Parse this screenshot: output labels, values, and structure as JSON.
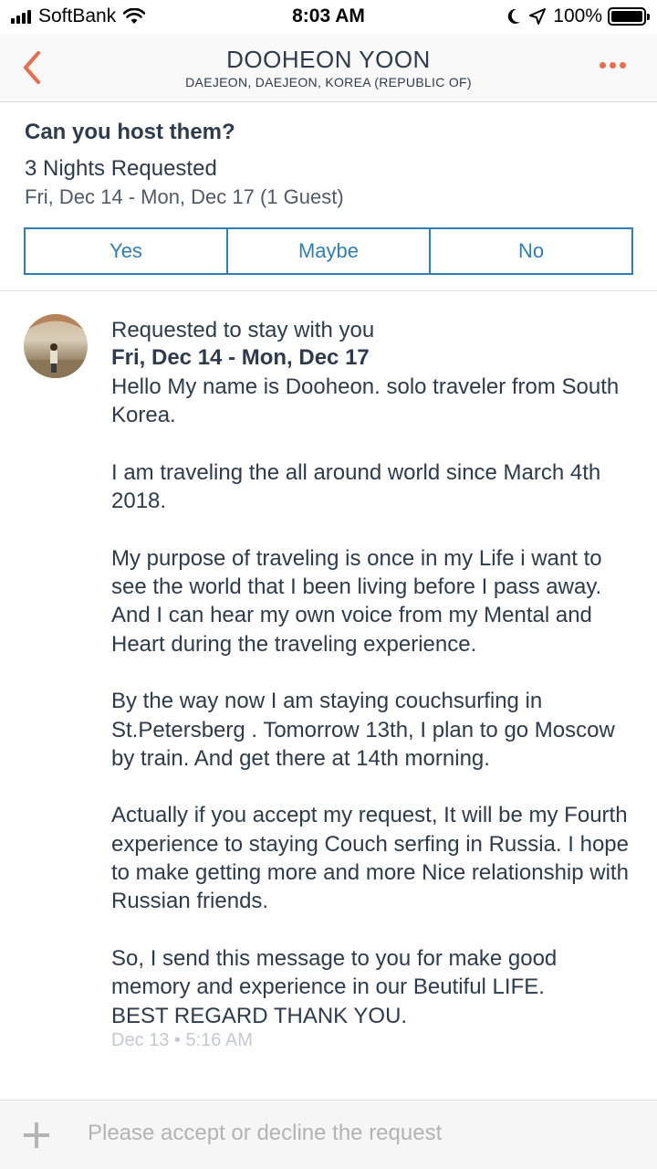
{
  "status_bar": {
    "carrier": "SoftBank",
    "time": "8:03 AM",
    "battery": "100%"
  },
  "header": {
    "title": "DOOHEON YOON",
    "subtitle": "DAEJEON, DAEJEON, KOREA (REPUBLIC OF)"
  },
  "request": {
    "question": "Can you host them?",
    "nights": "3 Nights Requested",
    "dates": "Fri, Dec 14 - Mon, Dec 17 (1 Guest)",
    "options": [
      "Yes",
      "Maybe",
      "No"
    ]
  },
  "message": {
    "title": "Requested to stay with you",
    "dates": "Fri, Dec 14 - Mon, Dec 17",
    "body": "Hello My name is Dooheon. solo traveler from South Korea.\n\nI am traveling the all around world since March 4th 2018.\n\nMy purpose of traveling is once in my Life i want to see the world that I been living before I pass away. And I can hear my own voice from my Mental and Heart during the traveling experience.\n\nBy the way now I am staying couchsurfing in St.Petersberg . Tomorrow 13th, I plan to go Moscow by train. And get there at 14th morning.\n\nActually if you accept my request, It will be my Fourth experience to staying Couch serfing in Russia. I hope to make getting more and more Nice relationship with Russian friends.\n\nSo, I send this message to you for make good memory and experience in our Beutiful LIFE.\nBEST REGARD THANK YOU.",
    "timestamp": "Dec 13 • 5:16 AM"
  },
  "composer": {
    "placeholder": "Please accept or decline the request"
  },
  "colors": {
    "accent": "#e96c4c",
    "button_blue": "#2d7fb5",
    "text_dark": "#2d3b4c"
  }
}
